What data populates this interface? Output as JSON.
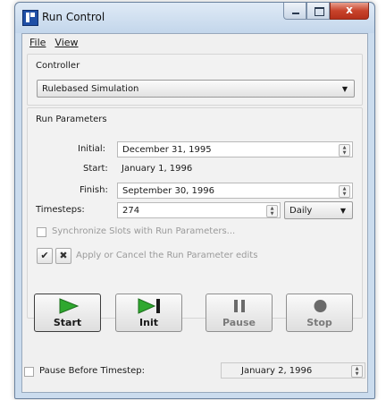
{
  "window": {
    "title": "Run Control",
    "close_glyph": "x"
  },
  "menu": {
    "file": "File",
    "view": "View"
  },
  "controller": {
    "section_label": "Controller",
    "selected": "Rulebased Simulation"
  },
  "run_parameters": {
    "section_label": "Run Parameters",
    "initial_label": "Initial:",
    "initial_value": "December 31, 1995",
    "start_label": "Start:",
    "start_value": "January 1, 1996",
    "finish_label": "Finish:",
    "finish_value": "September 30, 1996",
    "timesteps_label": "Timesteps:",
    "timesteps_value": "274",
    "timestep_unit": "Daily",
    "sync_label": "Synchronize Slots with Run Parameters...",
    "apply_cancel_label": "Apply or Cancel the Run Parameter edits"
  },
  "controls": {
    "start": "Start",
    "init": "Init",
    "pause": "Pause",
    "stop": "Stop"
  },
  "pause_before": {
    "label": "Pause Before Timestep:",
    "value": "January 2, 1996"
  },
  "colors": {
    "play_green": "#2fa82f",
    "close_red": "#c8432b",
    "title_bar": "#c3d6eb"
  },
  "icons": [
    "app-icon",
    "play-icon",
    "step-icon",
    "pause-icon",
    "stop-icon",
    "check-icon",
    "cancel-x-icon"
  ]
}
